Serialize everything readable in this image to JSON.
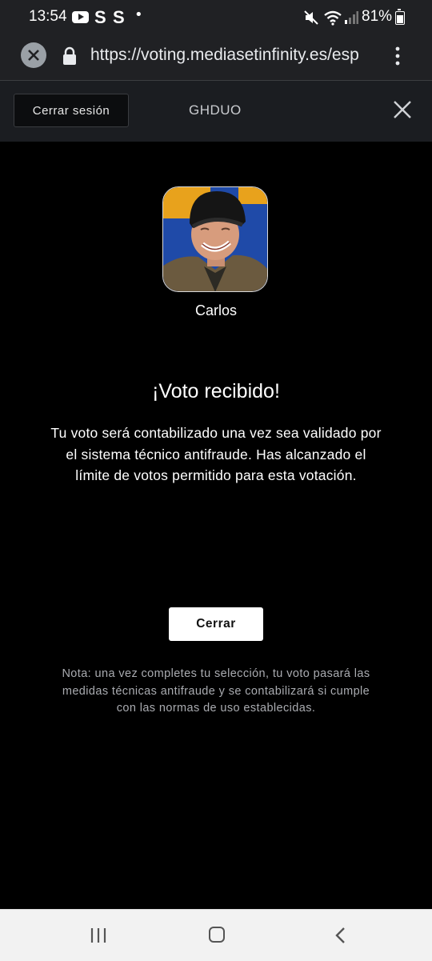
{
  "status_bar": {
    "time": "13:54",
    "app_letters": [
      "S",
      "S"
    ],
    "battery_percent": "81%"
  },
  "browser": {
    "url": "https://voting.mediasetinfinity.es/esp"
  },
  "header": {
    "logout_label": "Cerrar sesión",
    "title": "GHDUO"
  },
  "candidate": {
    "name": "Carlos"
  },
  "confirmation": {
    "heading": "¡Voto recibido!",
    "body": "Tu voto será contabilizado una vez sea validado por el sistema técnico antifraude. Has alcanzado el límite de votos permitido para esta votación.",
    "close_label": "Cerrar",
    "note": "Nota: una vez completes tu selección, tu voto pasará las medidas técnicas antifraude y se contabilizará si cumple con las normas de uso establecidas."
  },
  "icons": {
    "status": [
      "youtube-icon",
      "mute-icon",
      "wifi-icon",
      "signal-icon",
      "battery-icon"
    ],
    "browser": [
      "close-tab-icon",
      "lock-icon",
      "more-vert-icon"
    ],
    "header": [
      "close-icon"
    ],
    "nav": [
      "recent-apps-icon",
      "home-icon",
      "back-icon"
    ]
  },
  "colors": {
    "page_background": "#000000",
    "header_background": "#1b1d21",
    "browser_bar": "#202124",
    "note_text": "#a9abb0",
    "button_background": "#ffffff"
  }
}
